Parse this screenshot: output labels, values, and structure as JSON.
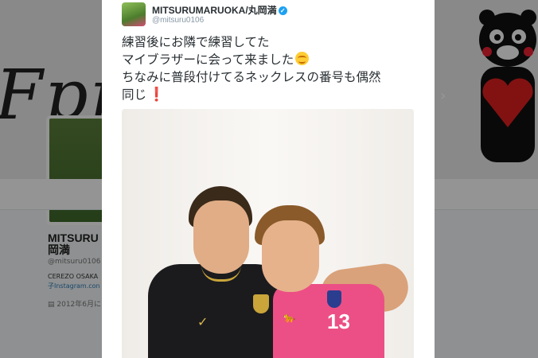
{
  "background": {
    "script_text": "Fpraw",
    "profile_name": "MITSURU\n岡満",
    "profile_handle": "@mitsuru0106",
    "bio": "CEREZO OSAKA",
    "bio_link": "子Instagram.con",
    "joined": "2012年6月に",
    "next_arrow": "›"
  },
  "tweet": {
    "user_name": "MITSURUMARUOKA/丸岡満",
    "user_handle": "@mitsuru0106",
    "verified_icon": "verified-badge-icon",
    "lines": [
      "練習後にお隣で練習してた",
      "マイブラザーに会って来ました",
      "ちなみに普段付けてるネックレスの番号も偶然",
      "同じ"
    ],
    "emoji_smile": "smiling-face-icon",
    "emoji_exclamation": "❗"
  },
  "photo": {
    "jersey_number": "13",
    "logo_nike": "✓",
    "logo_puma": "PUMA"
  },
  "colors": {
    "overlay": "#000000",
    "verified": "#1da1f2",
    "jersey_pink": "#ec4f85"
  }
}
